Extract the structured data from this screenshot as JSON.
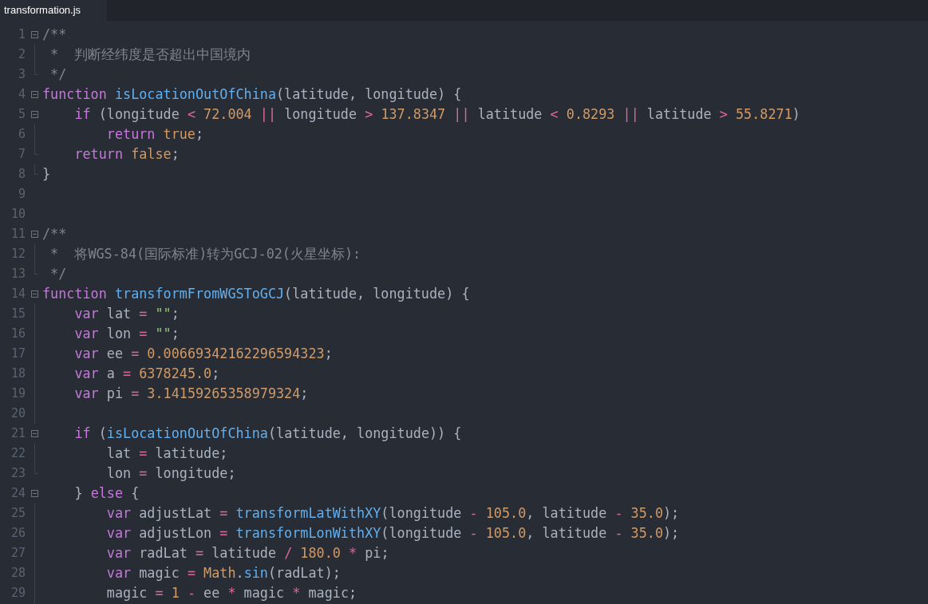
{
  "tabs": [
    {
      "label": "transformation.js",
      "selected": true
    }
  ],
  "editor": {
    "lines": [
      {
        "number": "1",
        "kind": "start",
        "tokens": [
          {
            "kind": "comment",
            "text": "/**"
          }
        ]
      },
      {
        "number": "2",
        "kind": "body",
        "tokens": [
          {
            "kind": "comment",
            "text": " *  判断经纬度是否超出中国境内"
          }
        ]
      },
      {
        "number": "3",
        "kind": "end",
        "tokens": [
          {
            "kind": "comment",
            "text": " */"
          }
        ]
      },
      {
        "number": "4",
        "kind": "start",
        "tokens": [
          {
            "kind": "keyword",
            "text": "function "
          },
          {
            "kind": "function",
            "text": "isLocationOutOfChina"
          },
          {
            "kind": "plain",
            "text": "(latitude, longitude) {"
          }
        ]
      },
      {
        "number": "5",
        "kind": "start",
        "tokens": [
          {
            "kind": "keyword",
            "text": "    if"
          },
          {
            "kind": "plain",
            "text": " (longitude "
          },
          {
            "kind": "operator",
            "text": "<"
          },
          {
            "kind": "number",
            "text": " 72.004 "
          },
          {
            "kind": "operator",
            "text": "||"
          },
          {
            "kind": "plain",
            "text": " longitude "
          },
          {
            "kind": "operator",
            "text": ">"
          },
          {
            "kind": "number",
            "text": " 137.8347 "
          },
          {
            "kind": "operator",
            "text": "||"
          },
          {
            "kind": "plain",
            "text": " latitude "
          },
          {
            "kind": "operator",
            "text": "<"
          },
          {
            "kind": "number",
            "text": " 0.8293 "
          },
          {
            "kind": "operator",
            "text": "||"
          },
          {
            "kind": "plain",
            "text": " latitude "
          },
          {
            "kind": "operator",
            "text": ">"
          },
          {
            "kind": "number",
            "text": " 55.8271"
          },
          {
            "kind": "plain",
            "text": ")"
          }
        ]
      },
      {
        "number": "6",
        "kind": "body",
        "tokens": [
          {
            "kind": "keyword",
            "text": "        return "
          },
          {
            "kind": "number",
            "text": "true"
          },
          {
            "kind": "plain",
            "text": ";"
          }
        ]
      },
      {
        "number": "7",
        "kind": "end",
        "tokens": [
          {
            "kind": "keyword",
            "text": "    return "
          },
          {
            "kind": "number",
            "text": "false"
          },
          {
            "kind": "plain",
            "text": ";"
          }
        ]
      },
      {
        "number": "8",
        "kind": "end",
        "tokens": [
          {
            "kind": "plain",
            "text": "}"
          }
        ]
      },
      {
        "number": "9",
        "kind": "none"
      },
      {
        "number": "10",
        "kind": "none"
      },
      {
        "number": "11",
        "kind": "start",
        "tokens": [
          {
            "kind": "comment",
            "text": "/**"
          }
        ]
      },
      {
        "number": "12",
        "kind": "body",
        "tokens": [
          {
            "kind": "comment",
            "text": " *  将WGS-84(国际标准)转为GCJ-02(火星坐标):"
          }
        ]
      },
      {
        "number": "13",
        "kind": "end",
        "tokens": [
          {
            "kind": "comment",
            "text": " */"
          }
        ]
      },
      {
        "number": "14",
        "kind": "start",
        "tokens": [
          {
            "kind": "keyword",
            "text": "function "
          },
          {
            "kind": "function",
            "text": "transformFromWGSToGCJ"
          },
          {
            "kind": "plain",
            "text": "(latitude, longitude) {"
          }
        ]
      },
      {
        "number": "15",
        "kind": "body",
        "tokens": [
          {
            "kind": "keyword",
            "text": "    var"
          },
          {
            "kind": "plain",
            "text": " lat "
          },
          {
            "kind": "operator",
            "text": "="
          },
          {
            "kind": "string",
            "text": " \"\""
          },
          {
            "kind": "plain",
            "text": ";"
          }
        ]
      },
      {
        "number": "16",
        "kind": "body",
        "tokens": [
          {
            "kind": "keyword",
            "text": "    var"
          },
          {
            "kind": "plain",
            "text": " lon "
          },
          {
            "kind": "operator",
            "text": "="
          },
          {
            "kind": "string",
            "text": " \"\""
          },
          {
            "kind": "plain",
            "text": ";"
          }
        ]
      },
      {
        "number": "17",
        "kind": "body",
        "tokens": [
          {
            "kind": "keyword",
            "text": "    var"
          },
          {
            "kind": "plain",
            "text": " ee "
          },
          {
            "kind": "operator",
            "text": "="
          },
          {
            "kind": "number",
            "text": " 0.00669342162296594323"
          },
          {
            "kind": "plain",
            "text": ";"
          }
        ]
      },
      {
        "number": "18",
        "kind": "body",
        "tokens": [
          {
            "kind": "keyword",
            "text": "    var"
          },
          {
            "kind": "plain",
            "text": " a "
          },
          {
            "kind": "operator",
            "text": "="
          },
          {
            "kind": "number",
            "text": " 6378245.0"
          },
          {
            "kind": "plain",
            "text": ";"
          }
        ]
      },
      {
        "number": "19",
        "kind": "body",
        "tokens": [
          {
            "kind": "keyword",
            "text": "    var"
          },
          {
            "kind": "plain",
            "text": " pi "
          },
          {
            "kind": "operator",
            "text": "="
          },
          {
            "kind": "number",
            "text": " 3.14159265358979324"
          },
          {
            "kind": "plain",
            "text": ";"
          }
        ]
      },
      {
        "number": "20",
        "kind": "body"
      },
      {
        "number": "21",
        "kind": "start",
        "tokens": [
          {
            "kind": "keyword",
            "text": "    if"
          },
          {
            "kind": "plain",
            "text": " ("
          },
          {
            "kind": "function",
            "text": "isLocationOutOfChina"
          },
          {
            "kind": "plain",
            "text": "(latitude, longitude)) {"
          }
        ]
      },
      {
        "number": "22",
        "kind": "body",
        "tokens": [
          {
            "kind": "plain",
            "text": "        lat "
          },
          {
            "kind": "operator",
            "text": "="
          },
          {
            "kind": "plain",
            "text": " latitude;"
          }
        ]
      },
      {
        "number": "23",
        "kind": "end",
        "tokens": [
          {
            "kind": "plain",
            "text": "        lon "
          },
          {
            "kind": "operator",
            "text": "="
          },
          {
            "kind": "plain",
            "text": " longitude;"
          }
        ]
      },
      {
        "number": "24",
        "kind": "start",
        "tokens": [
          {
            "kind": "plain",
            "text": "    } "
          },
          {
            "kind": "keyword",
            "text": "else"
          },
          {
            "kind": "plain",
            "text": " {"
          }
        ]
      },
      {
        "number": "25",
        "kind": "body",
        "tokens": [
          {
            "kind": "keyword",
            "text": "        var"
          },
          {
            "kind": "plain",
            "text": " adjustLat "
          },
          {
            "kind": "operator",
            "text": "="
          },
          {
            "kind": "function",
            "text": " transformLatWithXY"
          },
          {
            "kind": "plain",
            "text": "(longitude "
          },
          {
            "kind": "operator",
            "text": "-"
          },
          {
            "kind": "number",
            "text": " 105.0"
          },
          {
            "kind": "plain",
            "text": ", latitude "
          },
          {
            "kind": "operator",
            "text": "-"
          },
          {
            "kind": "number",
            "text": " 35.0"
          },
          {
            "kind": "plain",
            "text": ");"
          }
        ]
      },
      {
        "number": "26",
        "kind": "body",
        "tokens": [
          {
            "kind": "keyword",
            "text": "        var"
          },
          {
            "kind": "plain",
            "text": " adjustLon "
          },
          {
            "kind": "operator",
            "text": "="
          },
          {
            "kind": "function",
            "text": " transformLonWithXY"
          },
          {
            "kind": "plain",
            "text": "(longitude "
          },
          {
            "kind": "operator",
            "text": "-"
          },
          {
            "kind": "number",
            "text": " 105.0"
          },
          {
            "kind": "plain",
            "text": ", latitude "
          },
          {
            "kind": "operator",
            "text": "-"
          },
          {
            "kind": "number",
            "text": " 35.0"
          },
          {
            "kind": "plain",
            "text": ");"
          }
        ]
      },
      {
        "number": "27",
        "kind": "body",
        "tokens": [
          {
            "kind": "keyword",
            "text": "        var"
          },
          {
            "kind": "plain",
            "text": " radLat "
          },
          {
            "kind": "operator",
            "text": "="
          },
          {
            "kind": "plain",
            "text": " latitude "
          },
          {
            "kind": "operator",
            "text": "/"
          },
          {
            "kind": "number",
            "text": " 180.0 "
          },
          {
            "kind": "operator",
            "text": "*"
          },
          {
            "kind": "plain",
            "text": " pi;"
          }
        ]
      },
      {
        "number": "28",
        "kind": "body",
        "tokens": [
          {
            "kind": "keyword",
            "text": "        var"
          },
          {
            "kind": "plain",
            "text": " magic "
          },
          {
            "kind": "operator",
            "text": "="
          },
          {
            "kind": "number",
            "text": " Math"
          },
          {
            "kind": "plain",
            "text": "."
          },
          {
            "kind": "function",
            "text": "sin"
          },
          {
            "kind": "plain",
            "text": "(radLat);"
          }
        ]
      },
      {
        "number": "29",
        "kind": "body",
        "tokens": [
          {
            "kind": "plain",
            "text": "        magic "
          },
          {
            "kind": "operator",
            "text": "="
          },
          {
            "kind": "number",
            "text": " 1 "
          },
          {
            "kind": "operator",
            "text": "-"
          },
          {
            "kind": "plain",
            "text": " ee "
          },
          {
            "kind": "operator",
            "text": "*"
          },
          {
            "kind": "plain",
            "text": " magic "
          },
          {
            "kind": "operator",
            "text": "*"
          },
          {
            "kind": "plain",
            "text": " magic;"
          }
        ]
      }
    ]
  }
}
